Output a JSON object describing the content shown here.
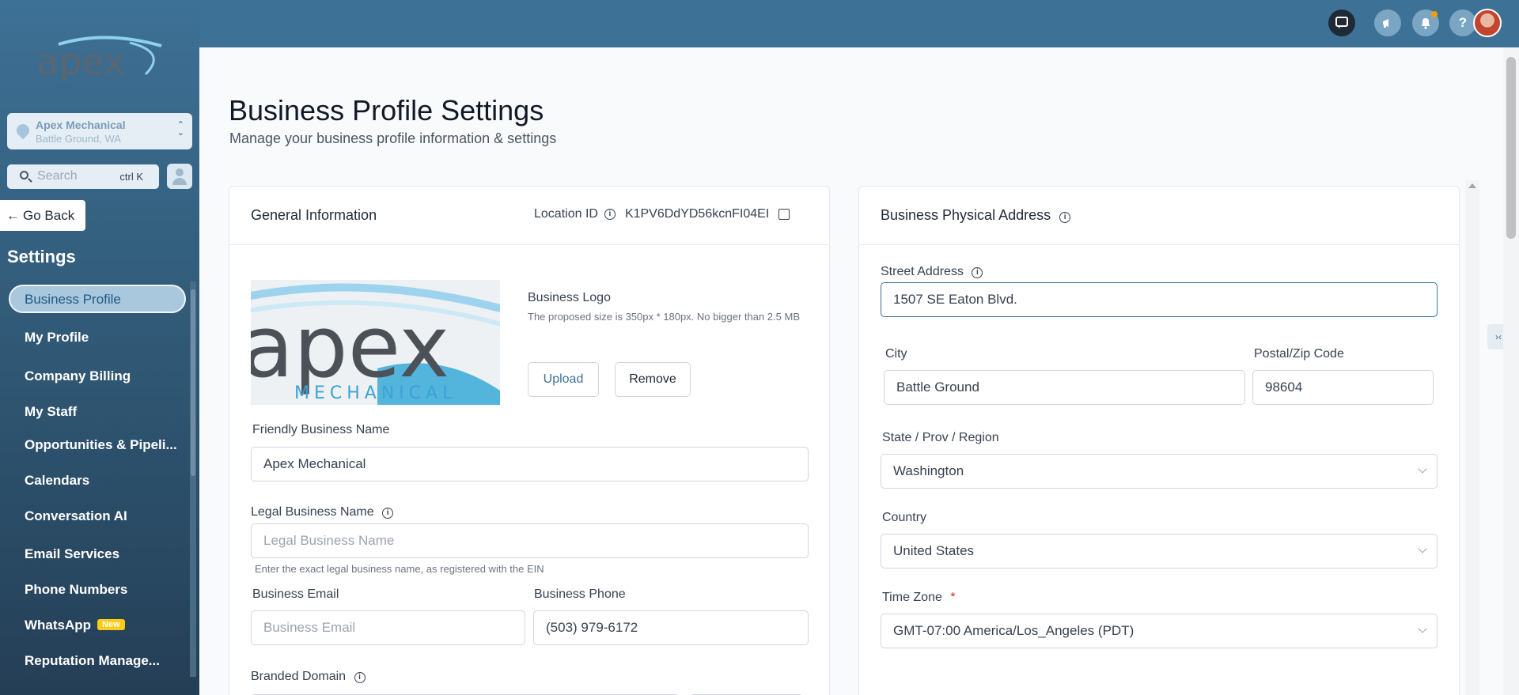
{
  "topbar": {
    "icons": [
      "chat-icon",
      "megaphone-icon",
      "bell-icon",
      "help-icon"
    ],
    "help_glyph": "?"
  },
  "sidebar": {
    "logo_text": "apex",
    "location": {
      "name": "Apex Mechanical",
      "city": "Battle Ground, WA"
    },
    "search": {
      "placeholder": "Search",
      "shortcut": "ctrl K"
    },
    "go_back": "Go Back",
    "section_title": "Settings",
    "items": [
      {
        "label": "Business Profile",
        "active": true
      },
      {
        "label": "My Profile"
      },
      {
        "label": "Company Billing"
      },
      {
        "label": "My Staff"
      },
      {
        "label": "Opportunities & Pipeli..."
      },
      {
        "label": "Calendars"
      },
      {
        "label": "Conversation AI"
      },
      {
        "label": "Email Services"
      },
      {
        "label": "Phone Numbers"
      },
      {
        "label": "WhatsApp",
        "badge": "New"
      },
      {
        "label": "Reputation Manage..."
      }
    ]
  },
  "page": {
    "title": "Business Profile Settings",
    "subtitle": "Manage your business profile information & settings"
  },
  "general": {
    "title": "General Information",
    "location_id_label": "Location ID",
    "location_id": "K1PV6DdYD56kcnFI04EI",
    "logo": {
      "label": "Business Logo",
      "hint": "The proposed size is 350px * 180px. No bigger than 2.5 MB",
      "upload": "Upload",
      "remove": "Remove",
      "image_text": "apex",
      "image_subtext": "MECHANICAL"
    },
    "friendly_name": {
      "label": "Friendly Business Name",
      "value": "Apex Mechanical"
    },
    "legal_name": {
      "label": "Legal Business Name",
      "placeholder": "Legal Business Name",
      "help": "Enter the exact legal business name, as registered with the EIN"
    },
    "email": {
      "label": "Business Email",
      "placeholder": "Business Email"
    },
    "phone": {
      "label": "Business Phone",
      "value": "(503) 979-6172"
    },
    "branded_domain": {
      "label": "Branded Domain"
    }
  },
  "address": {
    "title": "Business Physical Address",
    "street": {
      "label": "Street Address",
      "value": "1507 SE Eaton Blvd."
    },
    "city": {
      "label": "City",
      "value": "Battle Ground"
    },
    "zip": {
      "label": "Postal/Zip Code",
      "value": "98604"
    },
    "state": {
      "label": "State / Prov / Region",
      "value": "Washington"
    },
    "country": {
      "label": "Country",
      "value": "United States"
    },
    "timezone": {
      "label": "Time Zone",
      "required_mark": "*",
      "value": "GMT-07:00 America/Los_Angeles (PDT)"
    }
  },
  "colors": {
    "topbar": "#3e7196",
    "accent": "#3e7196",
    "active_nav_text": "#1e5a86",
    "badge": "#facc15"
  }
}
